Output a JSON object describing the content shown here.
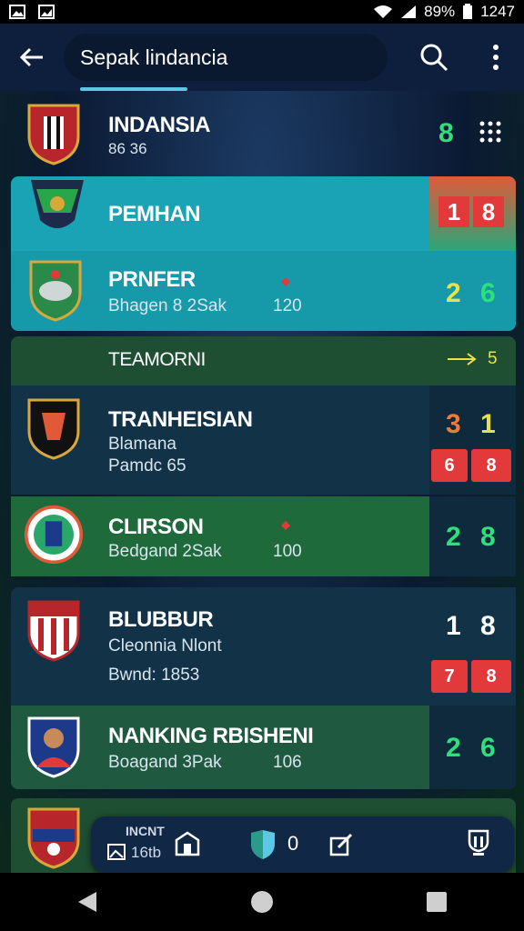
{
  "status_bar": {
    "battery": "89%",
    "time": "1247"
  },
  "app_bar": {
    "search_text": "Sepak lindancia"
  },
  "rows": [
    {
      "name": "INDANSIA",
      "sub1": "86 36",
      "score": "8"
    },
    {
      "name": "PEMHAN",
      "badge": [
        "1",
        "8"
      ]
    },
    {
      "name": "PRNFER",
      "sub1": "Bhagen 8 2Sak",
      "value": "120",
      "score": [
        "2",
        "6"
      ]
    },
    {
      "name": "TEAMORNI",
      "right": "5"
    },
    {
      "name": "TRANHEISIAN",
      "sub1": "Blamana",
      "sub2": "Pamdc 65",
      "score": [
        "3",
        "1"
      ],
      "badge": [
        "6",
        "8"
      ]
    },
    {
      "name": "CLIRSON",
      "sub1": "Bedgand 2Sak",
      "value": "100",
      "score": [
        "2",
        "8"
      ]
    },
    {
      "name": "BLUBBUR",
      "sub1": "Cleonnia Nlont",
      "sub2": "Bwnd: 1853",
      "score": [
        "1",
        "8"
      ],
      "badge": [
        "7",
        "8"
      ]
    },
    {
      "name": "NANKING RBISHENI",
      "sub1": "Boagand 3Pak",
      "value": "106",
      "score": [
        "2",
        "6"
      ]
    }
  ],
  "bottom_toolbar": {
    "left_label": "INCNT",
    "left_sub": "16tb",
    "count": "0"
  },
  "colors": {
    "accent_cyan": "#5cc8e6",
    "score_green": "#2ee07a",
    "badge_red": "#e23a3a",
    "teal_row": "#1aa3b5",
    "green_row": "#1f6a3a",
    "dark_row": "#123247"
  }
}
